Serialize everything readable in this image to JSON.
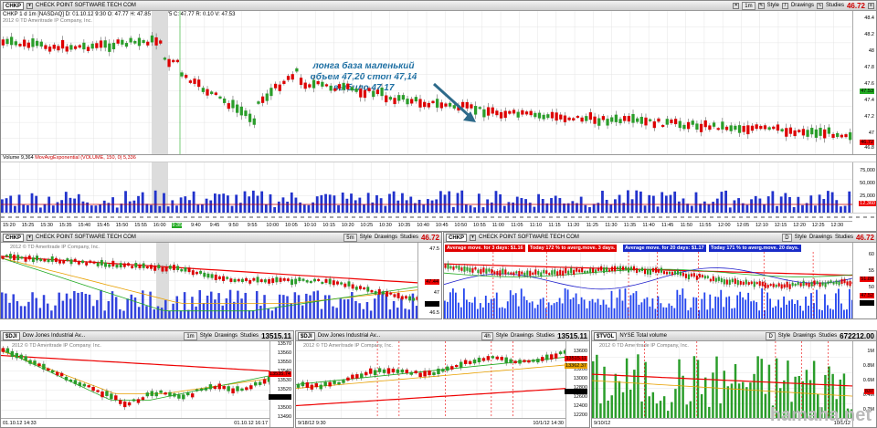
{
  "main": {
    "symbol": "CHKP",
    "company": "CHECK POINT SOFTWARE TECH COM",
    "timeframe": "1m",
    "style_label": "Style",
    "drawings_label": "Drawings",
    "studies_label": "Studies",
    "last_price": "46.72",
    "info_line": "CHKP 1 d 1m [NASDAQ]  D: 01.10.12 9:30  O: 47.77  H: 47.85  L: 47.75  C: 47.77  R: 0.10  V: 47.53",
    "copyright": "2012 © TD Ameritrade IP Company, Inc.",
    "note_lines": [
      "лонга база маленький",
      "объем 47,20 стоп 47,14",
      "выбило 47,17"
    ],
    "price_axis": [
      "48.4",
      "48.2",
      "48",
      "47.8",
      "47.6",
      "47.4",
      "47.2",
      "47",
      "46.8"
    ],
    "price_tag": "47.53",
    "price_tag2": "46.72",
    "volume_label": "Volume",
    "volume_value": "9,364",
    "volume_study": "MovAvgExponential (VOLUME, 150, 0)",
    "volume_study_value": "5,336",
    "volume_axis": [
      "75,000",
      "50,000",
      "25,000"
    ],
    "volume_tag": "12,360",
    "time_axis": [
      "15:20",
      "15:25",
      "15:30",
      "15:35",
      "15:40",
      "15:45",
      "15:50",
      "15:55",
      "16:00",
      "",
      "9:40",
      "9:45",
      "9:50",
      "9:55",
      "10:00",
      "10:05",
      "10:10",
      "10:15",
      "10:20",
      "10:25",
      "10:30",
      "10:35",
      "10:40",
      "10:45",
      "10:50",
      "10:55",
      "11:00",
      "11:05",
      "11:10",
      "11:15",
      "11:20",
      "11:25",
      "11:30",
      "11:35",
      "11:40",
      "11:45",
      "11:50",
      "11:55",
      "12:00",
      "12:05",
      "12:10",
      "12:15",
      "12:20",
      "12:25",
      "12:30"
    ],
    "time_highlight": "9:35"
  },
  "mid_left": {
    "symbol": "CHKP",
    "company": "CHECK POINT SOFTWARE TECH COM",
    "timeframe": "5m",
    "price": "46.72",
    "copyright": "2012 © TD Ameritrade IP Company, Inc.",
    "axis": [
      "47.5",
      "47",
      "46.5"
    ],
    "tag_red": "47.44",
    "tag_black": "46.73"
  },
  "mid_right": {
    "symbol": "CHKP",
    "company": "CHECK POINT SOFTWARE TECH COM",
    "timeframe": "D",
    "price": "46.72",
    "avg3": "Average move. for 3 days: $1.16",
    "today3": "Today 172 % to averg.move. 3 days.",
    "avg20": "Average move. for 20 days: $1.17",
    "today20": "Today 171 % to averg.move. 20 days.",
    "axis": [
      "60",
      "55",
      "50",
      "45"
    ],
    "tag_red": "51.88",
    "tag_red2": "47.52",
    "tag_black": "46.72"
  },
  "bottom_left": {
    "symbol": "$DJI",
    "company": "Dow Jones Industrial Av...",
    "timeframe": "1m",
    "price": "13515.11",
    "copyright": "2012 © TD Ameritrade IP Company, Inc.",
    "axis": [
      "13570",
      "13560",
      "13550",
      "13540",
      "13530",
      "13520",
      "13510",
      "13500",
      "13490"
    ],
    "tag_red": "13535.74",
    "tag_black": "13515.11",
    "x_left": "01.10.12 14:33",
    "x_right": "01.10.12 16:17"
  },
  "bottom_mid": {
    "symbol": "$DJI",
    "company": "Dow Jones Industrial Av...",
    "timeframe": "4h",
    "price": "13515.11",
    "copyright": "2012 © TD Ameritrade IP Company, Inc.",
    "axis": [
      "13600",
      "13400",
      "13200",
      "13000",
      "12800",
      "12600",
      "12400",
      "12200"
    ],
    "tag_red": "13515.11",
    "tag_orange": "13362.37",
    "tag_black": "13065.36",
    "x_left": "9/18/12 9:30",
    "x_right": "10/1/12 14:30"
  },
  "bottom_right": {
    "symbol": "$TVOL",
    "company": "NYSE Total volume",
    "timeframe": "D",
    "price": "672212.00",
    "copyright": "2012 © TD Ameritrade IP Company, Inc.",
    "axis": [
      "1M",
      "0.8M",
      "0.6M",
      "0.4M",
      "0.2M"
    ],
    "tag_red": "837",
    "x_left": "9/10/12",
    "x_right": "10/1/12"
  },
  "watermark": "hamaha.net"
}
